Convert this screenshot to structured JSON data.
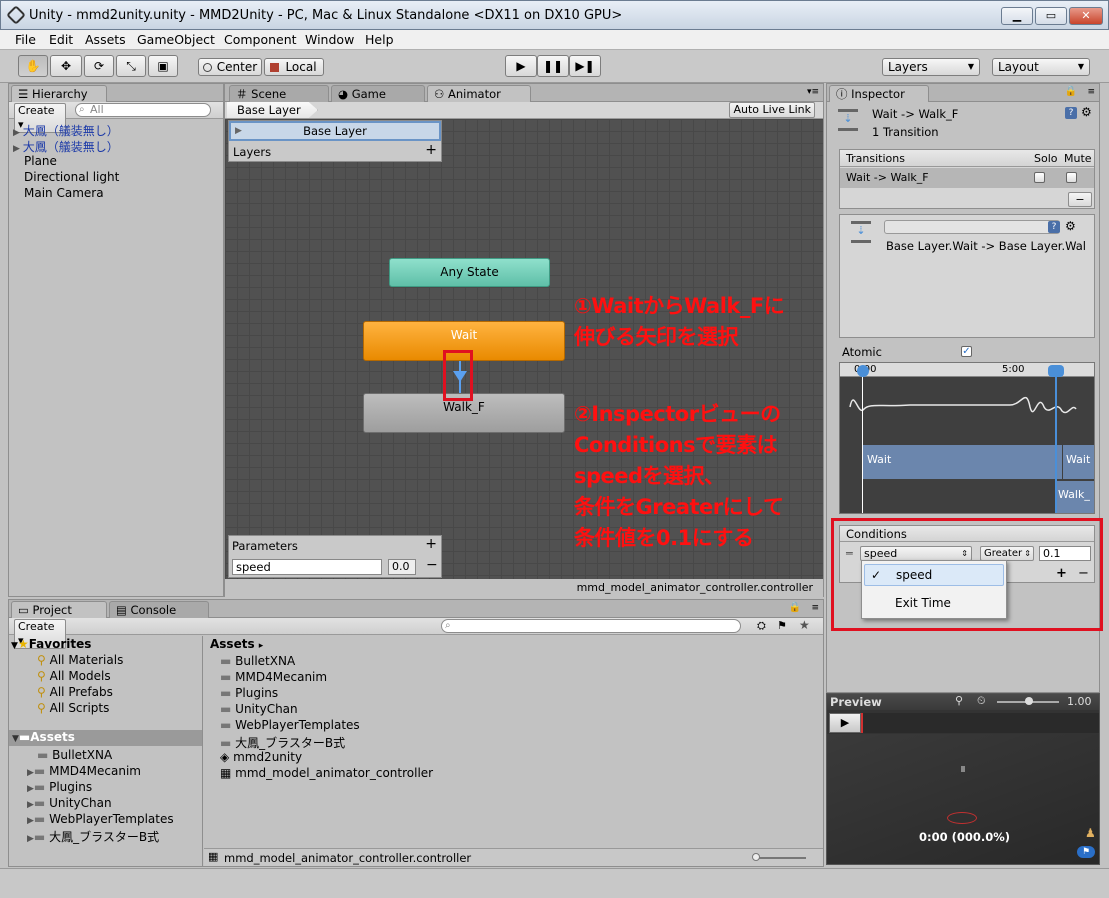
{
  "window": {
    "title": "Unity - mmd2unity.unity - MMD2Unity - PC, Mac & Linux Standalone <DX11 on DX10 GPU>"
  },
  "menu": [
    "File",
    "Edit",
    "Assets",
    "GameObject",
    "Component",
    "Window",
    "Help"
  ],
  "toolbar": {
    "center": "Center",
    "local": "Local",
    "layers": "Layers",
    "layout": "Layout"
  },
  "hierarchy": {
    "tab": "Hierarchy",
    "create": "Create",
    "search": "All",
    "items": [
      "大鳳（艤装無し）",
      "大鳳（艤装無し）",
      "Plane",
      "Directional light",
      "Main Camera"
    ]
  },
  "animator": {
    "tabs": [
      "Scene",
      "Game",
      "Animator"
    ],
    "breadcrumb": "Base Layer",
    "auto_live_link": "Auto Live Link",
    "layer_name": "Base Layer",
    "layers_label": "Layers",
    "any_state": "Any State",
    "wait": "Wait",
    "walk": "Walk_F",
    "parameters_label": "Parameters",
    "param_name": "speed",
    "param_value": "0.0",
    "footer": "mmd_model_animator_controller.controller",
    "annotation1": [
      "①WaitからWalk_Fに",
      "伸びる矢印を選択"
    ],
    "annotation2": [
      "②Inspectorビューの",
      "Conditionsで要素は",
      "speedを選択、",
      "条件をGreaterにして",
      "条件値を0.1にする"
    ]
  },
  "inspector": {
    "tab": "Inspector",
    "title": "Wait -> Walk_F",
    "subtitle": "1 Transition",
    "transitions_label": "Transitions",
    "solo": "Solo",
    "mute": "Mute",
    "transition_row": "Wait -> Walk_F",
    "minus": "−",
    "detail_name": "Base Layer.Wait -> Base Layer.Wal",
    "atomic": "Atomic",
    "tl_zero": "0:00",
    "tl_five": "5:00",
    "tl_wait1": "Wait",
    "tl_wait2": "Wait",
    "tl_walk": "Walk_",
    "conditions_label": "Conditions",
    "cond_param": "speed",
    "cond_op": "Greater",
    "cond_value": "0.1",
    "dropdown": [
      "speed",
      "Exit Time"
    ],
    "check": "✓",
    "plus": "+"
  },
  "preview": {
    "label": "Preview",
    "speed": "1.00",
    "time": "0:00 (000.0%)"
  },
  "project": {
    "tabs": [
      "Project",
      "Console"
    ],
    "create": "Create",
    "favorites": "Favorites",
    "fav_items": [
      "All Materials",
      "All Models",
      "All Prefabs",
      "All Scripts"
    ],
    "assets": "Assets",
    "tree": [
      "BulletXNA",
      "MMD4Mecanim",
      "Plugins",
      "UnityChan",
      "WebPlayerTemplates",
      "大鳳_ブラスターB式"
    ],
    "breadcrumb": "Assets",
    "files": [
      "BulletXNA",
      "MMD4Mecanim",
      "Plugins",
      "UnityChan",
      "WebPlayerTemplates",
      "大鳳_ブラスターB式",
      "mmd2unity",
      "mmd_model_animator_controller"
    ],
    "footer": "mmd_model_animator_controller.controller"
  },
  "colors": {
    "anystate": "#6fcfb8",
    "wait": "#f39a1c",
    "walk": "#a7a7a7",
    "red": "#ff1010",
    "graph": "#515151"
  }
}
